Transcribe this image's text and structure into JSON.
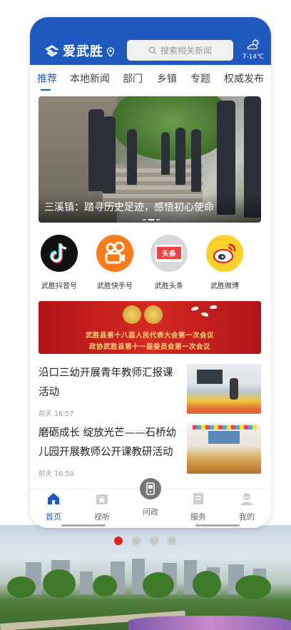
{
  "header": {
    "app_name": "爱武胜",
    "search_placeholder": "搜索相关新闻",
    "weather_temp": "7-14℃"
  },
  "tabs": [
    {
      "label": "推荐",
      "active": true
    },
    {
      "label": "本地新闻",
      "active": false
    },
    {
      "label": "部门",
      "active": false
    },
    {
      "label": "乡镇",
      "active": false
    },
    {
      "label": "专题",
      "active": false
    },
    {
      "label": "权威发布",
      "active": false
    }
  ],
  "banner": {
    "title": "三溪镇：踏寻历史足迹，感悟初心使命"
  },
  "apps": [
    {
      "label": "武胜抖音号",
      "icon": "douyin-icon"
    },
    {
      "label": "武胜快手号",
      "icon": "kuaishou-icon"
    },
    {
      "label": "武胜头条",
      "icon": "toutiao-icon"
    },
    {
      "label": "武胜微博",
      "icon": "weibo-icon"
    }
  ],
  "ad": {
    "line1": "武胜县第十八届人民代表大会第一次会议",
    "line2": "政协武胜县第十一届委员会第一次会议"
  },
  "news": [
    {
      "title": "沿口三幼开展青年教师汇报课活动",
      "time": "前天 16:57"
    },
    {
      "title": "磨砺成长 绽放光芒——石桥幼儿园开展教师公开课教研活动",
      "time": "前天 16:50"
    }
  ],
  "tabbar": [
    {
      "label": "首页",
      "icon": "home-icon",
      "active": true
    },
    {
      "label": "视听",
      "icon": "video-icon",
      "active": false
    },
    {
      "label": "问政",
      "icon": "inquiry-icon",
      "active": false
    },
    {
      "label": "服务",
      "icon": "service-icon",
      "active": false
    },
    {
      "label": "我的",
      "icon": "profile-icon",
      "active": false
    }
  ],
  "page_indicator": {
    "count": 4,
    "active_index": 0
  },
  "colors": {
    "brand": "#1f58bf",
    "indicator_active": "#e02020"
  }
}
